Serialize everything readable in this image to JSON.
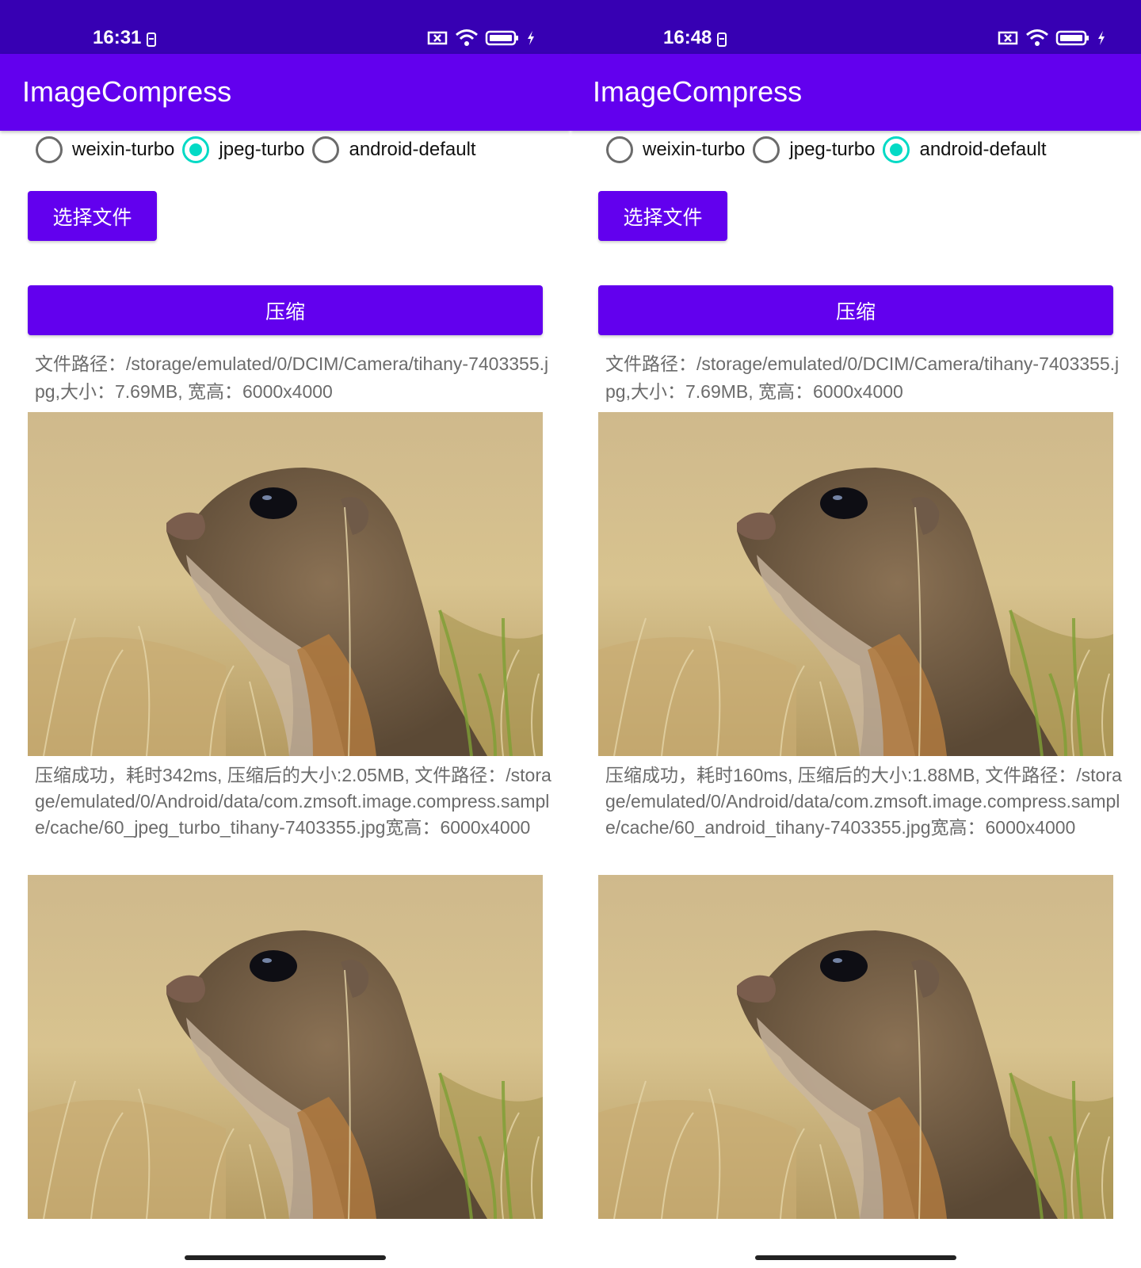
{
  "screens": [
    {
      "status": {
        "time": "16:31"
      },
      "app_title": "ImageCompress",
      "radios": [
        {
          "label": "weixin-turbo",
          "selected": false
        },
        {
          "label": "jpeg-turbo",
          "selected": true
        },
        {
          "label": "android-default",
          "selected": false
        }
      ],
      "select_button": "选择文件",
      "compress_button": "压缩",
      "source_info": "文件路径：/storage/emulated/0/DCIM/Camera/tihany-7403355.jpg,大小：7.69MB, 宽高：6000x4000",
      "result_info": "压缩成功，耗时342ms, 压缩后的大小:2.05MB, 文件路径：/storage/emulated/0/Android/data/com.zmsoft.image.compress.sample/cache/60_jpeg_turbo_tihany-7403355.jpg宽高：6000x4000"
    },
    {
      "status": {
        "time": "16:48"
      },
      "app_title": "ImageCompress",
      "radios": [
        {
          "label": "weixin-turbo",
          "selected": false
        },
        {
          "label": "jpeg-turbo",
          "selected": false
        },
        {
          "label": "android-default",
          "selected": true
        }
      ],
      "select_button": "选择文件",
      "compress_button": "压缩",
      "source_info": "文件路径：/storage/emulated/0/DCIM/Camera/tihany-7403355.jpg,大小：7.69MB, 宽高：6000x4000",
      "result_info": "压缩成功，耗时160ms, 压缩后的大小:1.88MB, 文件路径：/storage/emulated/0/Android/data/com.zmsoft.image.compress.sample/cache/60_android_tihany-7403355.jpg宽高：6000x4000"
    }
  ],
  "colors": {
    "status_bar": "#3700b3",
    "app_bar": "#6200ee",
    "button": "#6200ee",
    "radio_selected": "#03dac5",
    "info_text": "#6b6b6b"
  },
  "icons": [
    "sim-icon",
    "no-sim-icon",
    "wifi-icon",
    "battery-icon",
    "charging-icon"
  ]
}
